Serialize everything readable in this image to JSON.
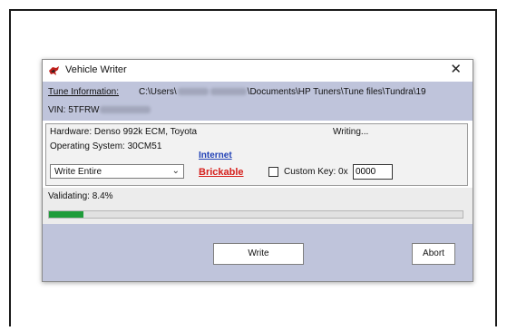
{
  "window": {
    "title": "Vehicle Writer",
    "close_glyph": "✕",
    "icon": "app-logo-icon"
  },
  "info": {
    "tune_label": "Tune Information:",
    "path_start": "C:\\Users\\",
    "path_end": "\\Documents\\HP Tuners\\Tune files\\Tundra\\19",
    "vin_prefix": "VIN: 5TFRW"
  },
  "panel": {
    "hardware": "Hardware: Denso 992k ECM,  Toyota",
    "status": "Writing...",
    "os": "Operating System: 30CM51",
    "link_internet": "Internet",
    "link_brickable": "Brickable",
    "mode_selected": "Write Entire",
    "custom_key_label": "Custom Key: 0x",
    "custom_key_value": "0000"
  },
  "progress": {
    "label": "Validating: 8.4%",
    "value": 0.084
  },
  "buttons": {
    "write": "Write",
    "abort": "Abort"
  },
  "colors": {
    "band": "#bfc4db",
    "progress_fill": "#1f9c3a",
    "link_blue": "#1f3fb5",
    "link_red": "#d6201c"
  }
}
